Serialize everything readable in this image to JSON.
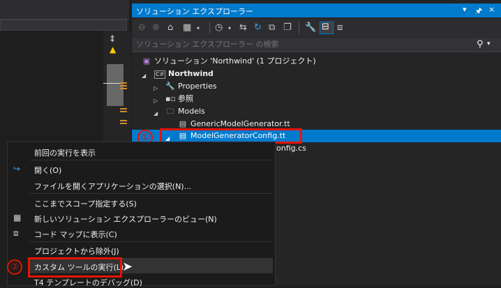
{
  "solution_explorer": {
    "title": "ソリューション エクスプローラー",
    "title_buttons": [
      "▾",
      "ᵖ",
      "×"
    ],
    "search_placeholder": "ソリューション エクスプローラー の検索",
    "tree": [
      {
        "label": "ソリューション 'Northwind' (1 プロジェクト)",
        "icon": "solution-icon"
      },
      {
        "label": "Northwind",
        "icon": "csharp-project-icon"
      },
      {
        "label": "Properties",
        "icon": "wrench-icon"
      },
      {
        "label": "参照",
        "icon": "references-icon"
      },
      {
        "label": "Models",
        "icon": "folder-icon"
      },
      {
        "label": "GenericModelGenerator.tt",
        "icon": "file-icon"
      },
      {
        "label": "ModelGeneratorConfig.tt",
        "icon": "file-icon"
      },
      {
        "label": "onfig.cs",
        "icon": "file-icon"
      }
    ]
  },
  "context_menu": {
    "items": [
      {
        "label": "前回の実行を表示"
      },
      {
        "label": "開く(O)",
        "icon": "open-arrow-icon"
      },
      {
        "label": "ファイルを開くアプリケーションの選択(N)..."
      },
      {
        "label": "ここまでスコープ指定する(S)"
      },
      {
        "label": "新しいソリューション エクスプローラーのビュー(N)",
        "icon": "new-view-icon"
      },
      {
        "label": "コード マップに表示(C)",
        "icon": "code-map-icon"
      },
      {
        "label": "プロジェクトから除外(J)"
      },
      {
        "label": "カスタム ツールの実行(L)"
      },
      {
        "label": "T4 テンプレートのデバッグ(D)"
      }
    ]
  },
  "annotations": {
    "badge1": "①",
    "badge2": "②"
  },
  "colors": {
    "accent": "#007acc",
    "highlight": "#e51400",
    "warning": "#ffcc00"
  }
}
